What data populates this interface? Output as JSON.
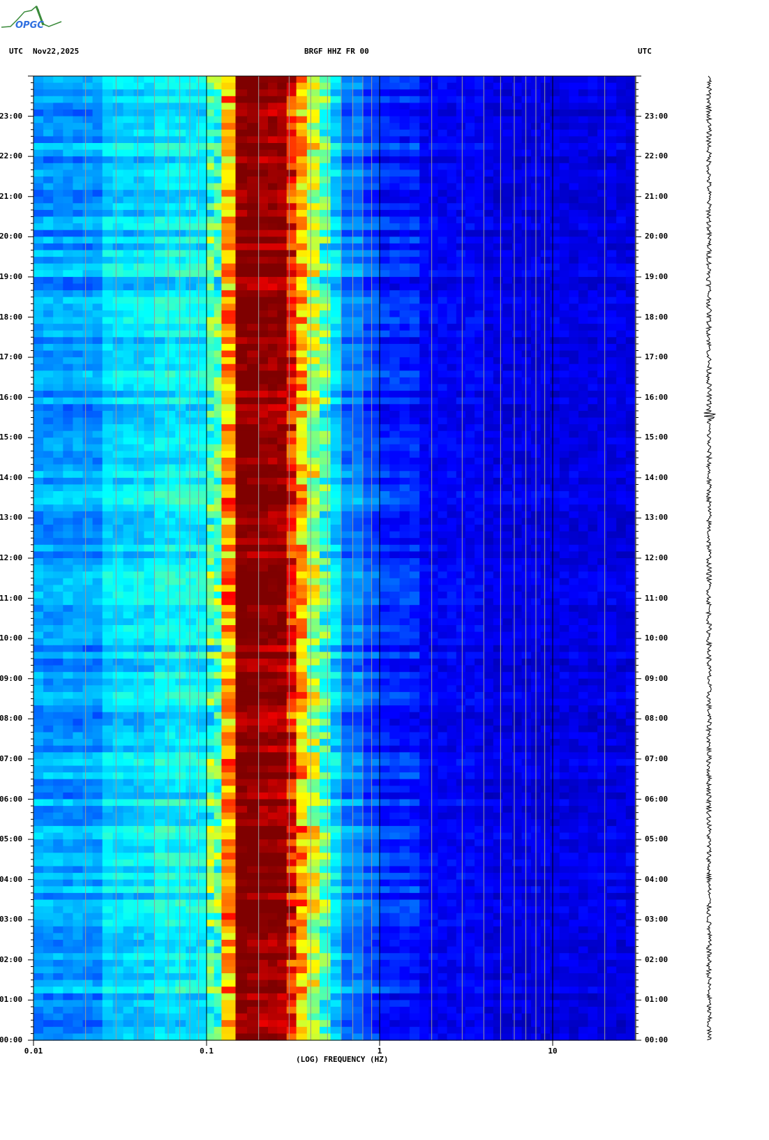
{
  "header": {
    "left_tz": "UTC",
    "date": "Nov22,2025",
    "station": "BRGF HHZ FR 00",
    "right_tz": "UTC",
    "logo_text": "OPGC"
  },
  "chart_data": {
    "type": "heatmap",
    "title": "BRGF HHZ FR 00",
    "xlabel": "(LOG) FREQUENCY (HZ)",
    "ylabel": "UTC",
    "xscale": "log",
    "xlim": [
      0.01,
      30
    ],
    "ylim_hours": [
      0,
      24
    ],
    "x_tick_labels": [
      "0.01",
      "0.1",
      "1",
      "10"
    ],
    "x_tick_values": [
      0.01,
      0.1,
      1,
      10
    ],
    "y_tick_labels": [
      "00:00",
      "01:00",
      "02:00",
      "03:00",
      "04:00",
      "05:00",
      "06:00",
      "07:00",
      "08:00",
      "09:00",
      "10:00",
      "11:00",
      "12:00",
      "13:00",
      "14:00",
      "15:00",
      "16:00",
      "17:00",
      "18:00",
      "19:00",
      "20:00",
      "21:00",
      "22:00",
      "23:00"
    ],
    "colormap": "jet",
    "frequency_bands_hz": [
      0.01,
      0.025,
      0.05,
      0.1,
      0.122,
      0.147,
      0.2,
      0.29,
      0.33,
      0.38,
      0.45,
      0.52,
      0.6,
      0.8,
      1.0,
      1.7,
      4,
      30
    ],
    "relative_power_level": [
      0.28,
      0.34,
      0.37,
      0.46,
      0.72,
      1.0,
      0.98,
      0.86,
      0.7,
      0.56,
      0.45,
      0.34,
      0.25,
      0.2,
      0.16,
      0.12,
      0.1
    ],
    "grid": true
  }
}
